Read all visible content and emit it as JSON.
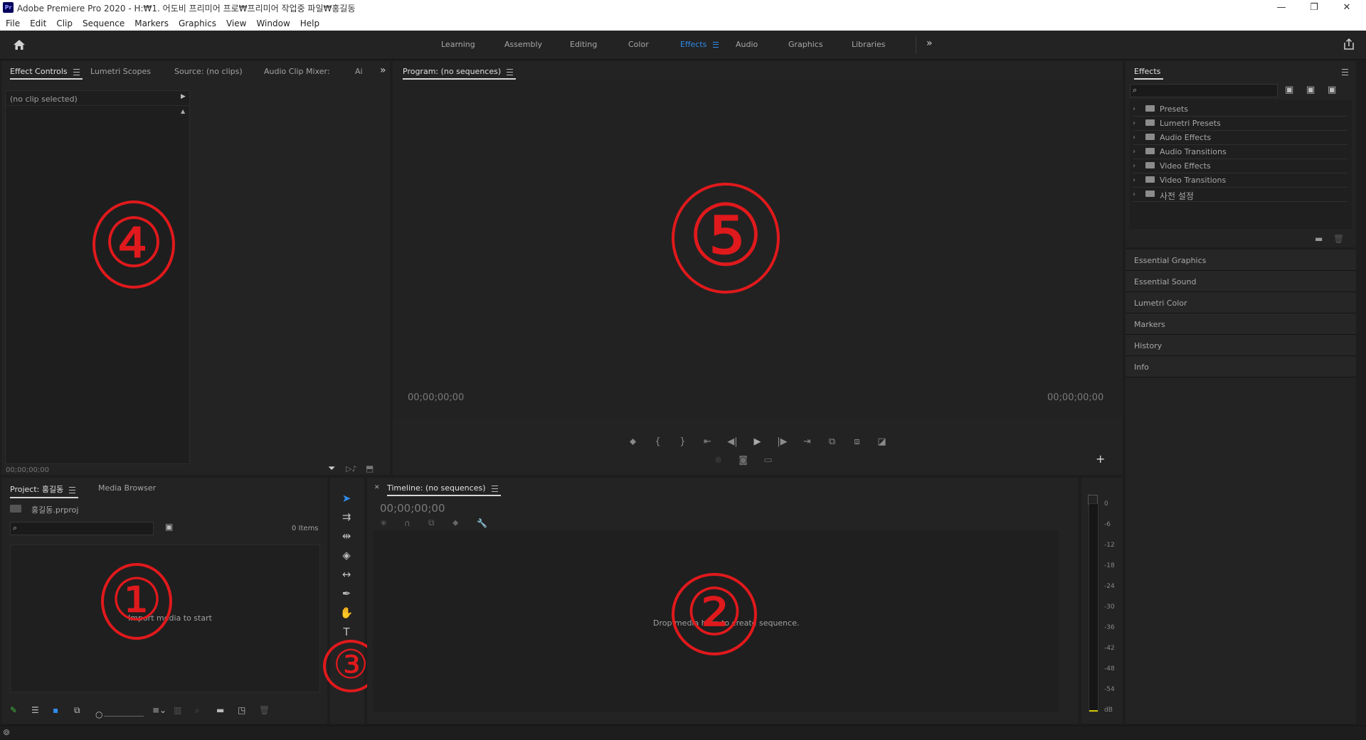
{
  "window": {
    "app_icon": "Pr",
    "title": "Adobe Premiere Pro 2020 - H:₩1. 어도비 프리미어 프로₩프리미어 작업중 파일₩홍길동",
    "controls": [
      "minimize-icon",
      "restore-icon",
      "close-icon"
    ]
  },
  "menu": [
    "File",
    "Edit",
    "Clip",
    "Sequence",
    "Markers",
    "Graphics",
    "View",
    "Window",
    "Help"
  ],
  "workspaces": {
    "tabs": [
      "Learning",
      "Assembly",
      "Editing",
      "Color",
      "Effects",
      "Audio",
      "Graphics",
      "Libraries"
    ],
    "active": "Effects",
    "more": "»"
  },
  "effect_controls": {
    "tabs": [
      "Effect Controls",
      "Lumetri Scopes",
      "Source: (no clips)",
      "Audio Clip Mixer:",
      "Ai"
    ],
    "clip_label": "(no clip selected)",
    "timecode": "00;00;00;00"
  },
  "program": {
    "tab": "Program: (no sequences)",
    "timecode_left": "00;00;00;00",
    "timecode_right": "00;00;00;00"
  },
  "effects_panel": {
    "title": "Effects",
    "search_placeholder": "",
    "items": [
      "Presets",
      "Lumetri Presets",
      "Audio Effects",
      "Audio Transitions",
      "Video Effects",
      "Video Transitions",
      "사전 설정"
    ],
    "side_panels": [
      "Essential Graphics",
      "Essential Sound",
      "Lumetri Color",
      "Markers",
      "History",
      "Info"
    ]
  },
  "project": {
    "tabs": [
      "Project: 홍길동",
      "Media Browser"
    ],
    "file": "홍길동.prproj",
    "items_count": "0 Items",
    "empty_hint": "Import media to start"
  },
  "timeline": {
    "tab": "Timeline: (no sequences)",
    "timecode": "00;00;00;00",
    "empty_hint": "Drop media here to create sequence."
  },
  "audio_meter": {
    "labels": [
      "0",
      "-6",
      "-12",
      "-18",
      "-24",
      "-30",
      "-36",
      "-42",
      "-48",
      "-54",
      "dB"
    ]
  },
  "annotations": [
    "④",
    "⑤",
    "①",
    "②",
    "③"
  ],
  "colors": {
    "accent": "#2d8ceb",
    "annotation": "#e0191c",
    "panel_bg": "#232323",
    "app_bg": "#1d1d1d"
  }
}
